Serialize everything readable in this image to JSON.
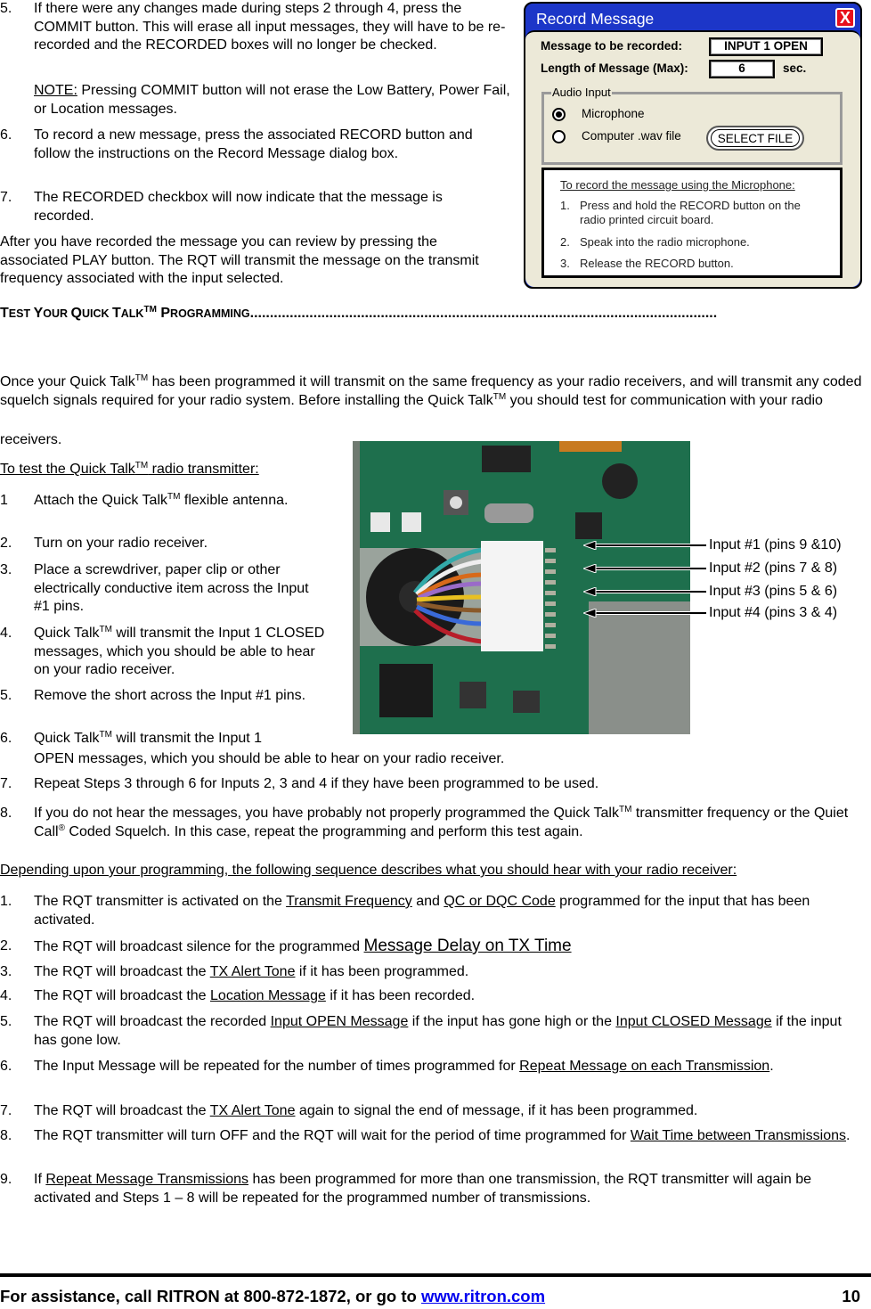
{
  "top_steps": [
    {
      "num": "5.",
      "text": "If there were any changes made during steps 2 through 4, press the COMMIT button.  This will erase all input messages, they will have to be re-recorded and the RECORDED boxes will no longer be checked."
    },
    {
      "num": "6.",
      "text": "To record a new message, press the associated RECORD button and follow the instructions on the Record Message dialog box."
    },
    {
      "num": "7.",
      "text": "The RECORDED checkbox will now indicate that the message is recorded."
    }
  ],
  "note": {
    "label": "NOTE:",
    "text": " Pressing COMMIT button will not erase the Low Battery, Power Fail, or Location messages."
  },
  "after_paragraph": "After you have recorded the message you can review by pressing the associated PLAY button.  The RQT will transmit the message on the transmit frequency associated with the input selected.",
  "dialog": {
    "title": "Record Message",
    "close_label": "X",
    "message_label": "Message to be recorded:",
    "message_value": "INPUT 1 OPEN",
    "length_label": "Length of Message (Max):",
    "length_value": "6",
    "length_unit": "sec.",
    "audio_group": "Audio Input",
    "options": [
      {
        "label": "Microphone",
        "selected": true
      },
      {
        "label": "Computer .wav file",
        "selected": false
      }
    ],
    "select_file": "SELECT FILE",
    "instructions_title": "To record the message using the Microphone:",
    "instructions": [
      {
        "num": "1.",
        "text": "Press and hold the RECORD button on the radio printed circuit board."
      },
      {
        "num": "2.",
        "text": "Speak into the radio microphone."
      },
      {
        "num": "3.",
        "text": "Release the RECORD button."
      }
    ]
  },
  "section": {
    "heading_parts": [
      "T",
      "EST ",
      "Y",
      "OUR ",
      "Q",
      "UICK ",
      "T",
      "ALK",
      "TM",
      " P",
      "ROGRAMMING"
    ],
    "leader": "......................................................................................................................",
    "intro_1": "Once your Quick Talk",
    "intro_2": " has been programmed it will transmit on the same frequency as your radio receivers, and will transmit any coded squelch signals required for your radio system.   Before installing the Quick Talk",
    "intro_3": " you should test for communication with your radio",
    "intro_4": "receivers.",
    "tm": "TM",
    "subheading_1": "To test the Quick Talk",
    "subheading_2": " radio transmitter:"
  },
  "test_steps": [
    {
      "num": "1",
      "pre": " Attach the Quick Talk",
      "tm": true,
      "post": " flexible antenna."
    },
    {
      "num": "2.",
      "pre": "Turn on your radio receiver.",
      "tm": false,
      "post": ""
    },
    {
      "num": "3.",
      "pre": "Place a screwdriver, paper clip or other electrically conductive item across the Input #1 pins.",
      "tm": false,
      "post": ""
    },
    {
      "num": "4.",
      "pre": "Quick Talk",
      "tm": true,
      "post": " will transmit the Input 1 CLOSED messages, which you should be able to hear on your radio receiver."
    },
    {
      "num": "5.",
      "pre": "Remove the short across the Input #1 pins.",
      "tm": false,
      "post": ""
    },
    {
      "num": "6.",
      "pre": "Quick Talk",
      "tm": true,
      "post": " will transmit the Input 1"
    },
    {
      "num": "",
      "pre": "OPEN messages, which you should be able to hear on your radio receiver.",
      "tm": false,
      "post": ""
    },
    {
      "num": "7.",
      "pre": "Repeat Steps 3 through 6 for Inputs 2, 3 and 4 if they have been programmed to be used.",
      "tm": false,
      "post": ""
    }
  ],
  "step8": {
    "num": "8.",
    "a": "If you do not hear the messages, you have probably not properly programmed the Quick Talk",
    "tm": "TM",
    "b": " transmitter frequency or the Quiet Call",
    "reg": "®",
    "c": " Coded Squelch.  In this case, repeat the programming and perform this test again."
  },
  "photo": {
    "alt": "circuit-board-photo",
    "callouts": [
      "Input #1 (pins 9 &10)",
      "Input #2 (pins 7 & 8)",
      "Input #3 (pins 5 & 6)",
      "Input #4 (pins 3 & 4)"
    ]
  },
  "sequence_heading": "Depending upon your programming, the following sequence describes what you should hear with your radio receiver:",
  "sequence": [
    {
      "num": "1.",
      "parts": [
        {
          "t": "The RQT transmitter is activated on the "
        },
        {
          "t": "Transmit Frequency",
          "u": true
        },
        {
          "t": " and "
        },
        {
          "t": "QC or DQC Code",
          "u": true
        },
        {
          "t": " programmed for the input that has been activated."
        }
      ]
    },
    {
      "num": "2.",
      "parts": [
        {
          "t": "The RQT will broadcast silence for the programmed "
        },
        {
          "t": "Message Delay on TX Time",
          "u": true,
          "big": true
        }
      ]
    },
    {
      "num": "3.",
      "parts": [
        {
          "t": "The RQT will broadcast the "
        },
        {
          "t": "TX Alert Tone",
          "u": true
        },
        {
          "t": " if it has been programmed."
        }
      ]
    },
    {
      "num": "4.",
      "parts": [
        {
          "t": "The RQT will broadcast the "
        },
        {
          "t": "Location Message",
          "u": true
        },
        {
          "t": " if it has been recorded."
        }
      ]
    },
    {
      "num": "5.",
      "parts": [
        {
          "t": "The RQT will broadcast the recorded "
        },
        {
          "t": "Input OPEN Message",
          "u": true
        },
        {
          "t": " if the input has gone high or the "
        },
        {
          "t": "Input CLOSED Message",
          "u": true
        },
        {
          "t": " if the input has gone low."
        }
      ]
    },
    {
      "num": "6.",
      "parts": [
        {
          "t": "The Input Message will be repeated for the number of times programmed for "
        },
        {
          "t": "Repeat Message on each Transmission",
          "u": true
        },
        {
          "t": "."
        }
      ]
    },
    {
      "num": "7.",
      "parts": [
        {
          "t": "The RQT will broadcast the "
        },
        {
          "t": "TX Alert Tone",
          "u": true
        },
        {
          "t": " again to signal the end of message, if it has been programmed."
        }
      ]
    },
    {
      "num": "8.",
      "parts": [
        {
          "t": "The RQT transmitter will turn OFF and the RQT will wait for the period of time programmed for "
        },
        {
          "t": "Wait Time between Transmissions",
          "u": true
        },
        {
          "t": "."
        }
      ]
    },
    {
      "num": "9.",
      "parts": [
        {
          "t": "If "
        },
        {
          "t": "Repeat Message Transmissions",
          "u": true
        },
        {
          "t": " has been programmed for more than one transmission, the RQT transmitter will again be activated and Steps 1 – 8 will be repeated for the programmed number of transmissions."
        }
      ]
    }
  ],
  "footer": {
    "text": "For assistance, call RITRON at 800-872-1872, or go to ",
    "link": "www.ritron.com",
    "page": "10"
  }
}
